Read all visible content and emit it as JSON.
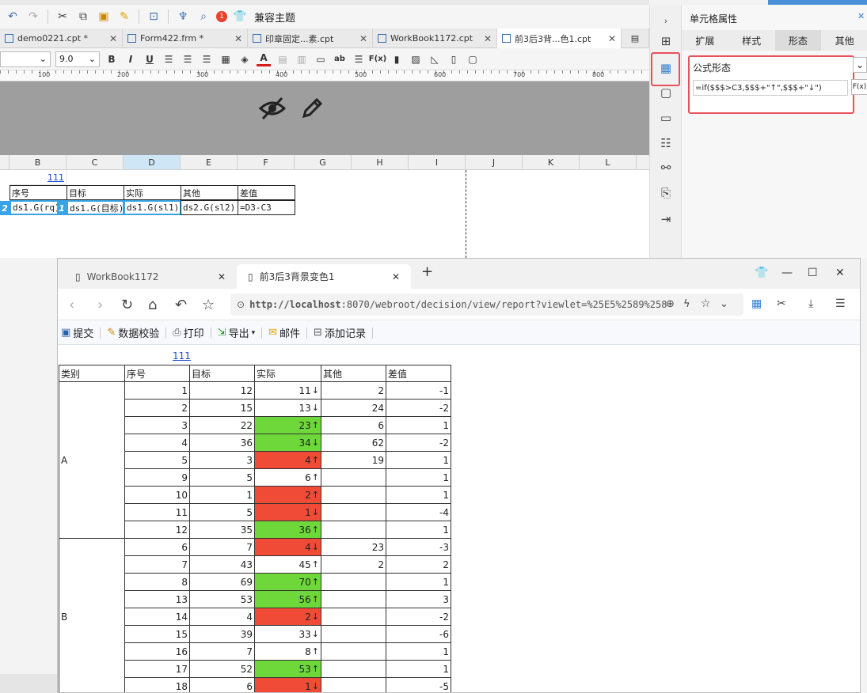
{
  "designer": {
    "toolbar": {
      "compat_theme": "兼容主题",
      "badge": "1"
    },
    "tabs": [
      {
        "label": "demo0221.cpt *"
      },
      {
        "label": "Form422.frm *"
      },
      {
        "label": "印章固定...素.cpt"
      },
      {
        "label": "WorkBook1172.cpt"
      },
      {
        "label": "前3后3背...色1.cpt"
      }
    ],
    "format": {
      "font_size": "9.0",
      "bold": "B",
      "italic": "I",
      "underline": "U"
    },
    "ruler_labels": [
      "100",
      "200",
      "300",
      "400",
      "500",
      "600",
      "700",
      "800"
    ],
    "columns": [
      "B",
      "C",
      "D",
      "E",
      "F",
      "G",
      "H",
      "I",
      "J",
      "K",
      "L"
    ],
    "grid": {
      "top_value": "111",
      "headers": [
        "序号",
        "目标",
        "实际",
        "其他",
        "差值"
      ],
      "formulas": [
        "ds1.G(rq)",
        "ds1.G(目标)",
        "ds1.G(sl1)",
        "ds2.G(sl2)",
        "=D3-C3"
      ],
      "markers": [
        "2",
        "1"
      ]
    }
  },
  "cell_props": {
    "title": "单元格属性",
    "tabs": [
      "扩展",
      "样式",
      "形态",
      "其他"
    ],
    "active_tab": "形态",
    "formula_label": "公式形态",
    "formula_value": "=if($$$>C3,$$$+\"↑\",$$$+\"↓\")",
    "fx": "F(x)"
  },
  "browser": {
    "tabs": [
      {
        "label": "WorkBook1172"
      },
      {
        "label": "前3后3背景变色1"
      }
    ],
    "url_host": "http://localhost",
    "url_rest": ":8070/webroot/decision/view/report?viewlet=%25E5%2589%258",
    "toolbar": [
      "提交",
      "数据校验",
      "打印",
      "导出",
      "邮件",
      "添加记录"
    ]
  },
  "report": {
    "top_value": "111",
    "headers": [
      "类别",
      "序号",
      "目标",
      "实际",
      "其他",
      "差值"
    ],
    "groups": [
      {
        "name": "A",
        "rows": [
          {
            "seq": "1",
            "target": "12",
            "actual": "11",
            "arrow": "↓",
            "other": "2",
            "diff": "-1",
            "color": ""
          },
          {
            "seq": "2",
            "target": "15",
            "actual": "13",
            "arrow": "↓",
            "other": "24",
            "diff": "-2",
            "color": ""
          },
          {
            "seq": "3",
            "target": "22",
            "actual": "23",
            "arrow": "↑",
            "other": "6",
            "diff": "1",
            "color": "#6ed83a"
          },
          {
            "seq": "4",
            "target": "36",
            "actual": "34",
            "arrow": "↓",
            "other": "62",
            "diff": "-2",
            "color": "#6ed83a"
          },
          {
            "seq": "5",
            "target": "3",
            "actual": "4",
            "arrow": "↑",
            "other": "19",
            "diff": "1",
            "color": "#ef4b36"
          },
          {
            "seq": "9",
            "target": "5",
            "actual": "6",
            "arrow": "↑",
            "other": "",
            "diff": "1",
            "color": ""
          },
          {
            "seq": "10",
            "target": "1",
            "actual": "2",
            "arrow": "↑",
            "other": "",
            "diff": "1",
            "color": "#ef4b36"
          },
          {
            "seq": "11",
            "target": "5",
            "actual": "1",
            "arrow": "↓",
            "other": "",
            "diff": "-4",
            "color": "#ef4b36"
          },
          {
            "seq": "12",
            "target": "35",
            "actual": "36",
            "arrow": "↑",
            "other": "",
            "diff": "1",
            "color": "#6ed83a"
          }
        ]
      },
      {
        "name": "B",
        "rows": [
          {
            "seq": "6",
            "target": "7",
            "actual": "4",
            "arrow": "↓",
            "other": "23",
            "diff": "-3",
            "color": "#ef4b36"
          },
          {
            "seq": "7",
            "target": "43",
            "actual": "45",
            "arrow": "↑",
            "other": "2",
            "diff": "2",
            "color": ""
          },
          {
            "seq": "8",
            "target": "69",
            "actual": "70",
            "arrow": "↑",
            "other": "",
            "diff": "1",
            "color": "#6ed83a"
          },
          {
            "seq": "13",
            "target": "53",
            "actual": "56",
            "arrow": "↑",
            "other": "",
            "diff": "3",
            "color": "#6ed83a"
          },
          {
            "seq": "14",
            "target": "4",
            "actual": "2",
            "arrow": "↓",
            "other": "",
            "diff": "-2",
            "color": "#ef4b36"
          },
          {
            "seq": "15",
            "target": "39",
            "actual": "33",
            "arrow": "↓",
            "other": "",
            "diff": "-6",
            "color": ""
          },
          {
            "seq": "16",
            "target": "7",
            "actual": "8",
            "arrow": "↑",
            "other": "",
            "diff": "1",
            "color": ""
          },
          {
            "seq": "17",
            "target": "52",
            "actual": "53",
            "arrow": "↑",
            "other": "",
            "diff": "1",
            "color": "#6ed83a"
          },
          {
            "seq": "18",
            "target": "6",
            "actual": "1",
            "arrow": "↓",
            "other": "",
            "diff": "-5",
            "color": "#ef4b36"
          }
        ]
      }
    ]
  }
}
